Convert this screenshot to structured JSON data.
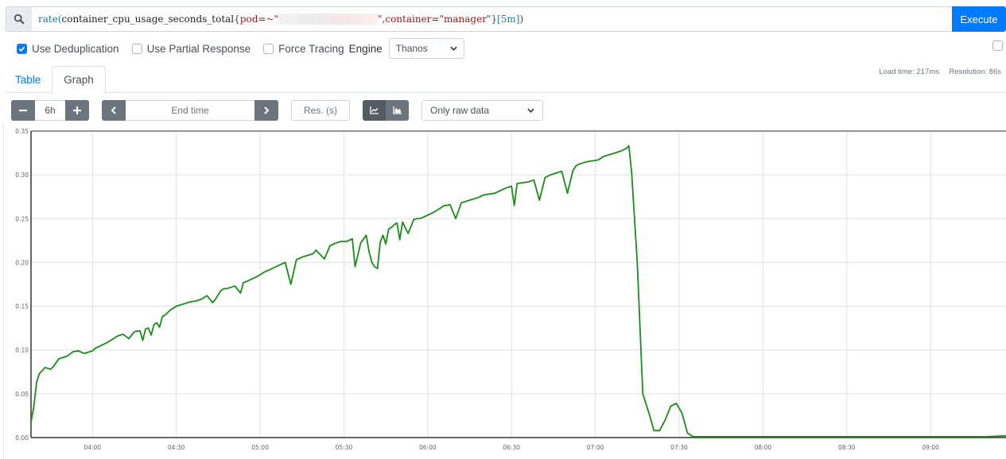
{
  "query": {
    "search_icon": "search-icon",
    "parts": {
      "fn": "rate(",
      "metric": "container_cpu_usage_seconds_total",
      "open_brace": "{",
      "label1": "pod=~\"",
      "label1_end": "\"",
      "label2": ",container=\"manager\"",
      "close_brace": "}",
      "range": "[5m]",
      "close_paren": ")"
    },
    "execute_label": "Execute"
  },
  "options": {
    "dedup": {
      "label": "Use Deduplication",
      "checked": true
    },
    "partial": {
      "label": "Use Partial Response",
      "checked": false
    },
    "tracing": {
      "label": "Force Tracing",
      "checked": false
    },
    "engine_label": "Engine",
    "engine_value": "Thanos"
  },
  "status": {
    "load_time": "Load time: 217ms",
    "resolution": "Resolution: 86s"
  },
  "tabs": [
    {
      "label": "Table",
      "active": false
    },
    {
      "label": "Graph",
      "active": true
    }
  ],
  "controls": {
    "minus_label": "−",
    "range_value": "6h",
    "plus_label": "+",
    "prev_label": "‹",
    "end_time_placeholder": "End time",
    "next_label": "›",
    "res_placeholder": "Res. (s)",
    "downsampling_value": "Only raw data"
  },
  "colors": {
    "accent": "#007bff",
    "series": "#1a8c1a",
    "grid": "#e0e0e0",
    "axis": "#333333"
  },
  "chart_data": {
    "type": "line",
    "title": "",
    "xlabel": "",
    "ylabel": "",
    "x_unit": "time (HH:MM)",
    "xlim": [
      "03:38",
      "09:27"
    ],
    "ylim": [
      0,
      0.35
    ],
    "grid": true,
    "legend": "none",
    "y_ticks": [
      "0.00",
      "0.05",
      "0.10",
      "0.15",
      "0.20",
      "0.25",
      "0.30",
      "0.35"
    ],
    "x_ticks": [
      "04:00",
      "04:30",
      "05:00",
      "05:30",
      "06:00",
      "06:30",
      "07:00",
      "07:30",
      "08:00",
      "08:30",
      "09:00"
    ],
    "series": [
      {
        "name": "rate(container_cpu_usage_seconds_total{container=\"manager\"}[5m])",
        "x": [
          "03:38",
          "03:39",
          "03:40",
          "03:41",
          "03:43",
          "03:45",
          "03:46",
          "03:48",
          "03:49",
          "03:51",
          "03:53",
          "03:55",
          "03:57",
          "03:58",
          "04:00",
          "04:01",
          "04:03",
          "04:05",
          "04:07",
          "04:09",
          "04:11",
          "04:13",
          "04:15",
          "04:17",
          "04:18",
          "04:19",
          "04:20",
          "04:21",
          "04:22",
          "04:23",
          "04:24",
          "04:25",
          "04:26",
          "04:27",
          "04:28",
          "04:29",
          "04:30",
          "04:31",
          "04:33",
          "04:35",
          "04:37",
          "04:39",
          "04:41",
          "04:43",
          "04:44",
          "04:46",
          "04:47",
          "04:48",
          "04:50",
          "04:51",
          "04:53",
          "04:54",
          "04:55",
          "04:57",
          "04:59",
          "05:00",
          "05:01",
          "05:02",
          "05:03",
          "05:05",
          "05:07",
          "05:09",
          "05:11",
          "05:13",
          "05:15",
          "05:17",
          "05:19",
          "05:20",
          "05:23",
          "05:25",
          "05:27",
          "05:29",
          "05:31",
          "05:33",
          "05:34",
          "05:36",
          "05:38",
          "05:39",
          "05:40",
          "05:41",
          "05:42",
          "05:43",
          "05:44",
          "05:45",
          "05:46",
          "05:47",
          "05:48",
          "05:49",
          "05:50",
          "05:51",
          "05:53",
          "05:55",
          "05:56",
          "05:57",
          "05:58",
          "06:00",
          "06:02",
          "06:03",
          "06:04",
          "06:05",
          "06:06",
          "06:07",
          "06:08",
          "06:10",
          "06:12",
          "06:14",
          "06:16",
          "06:18",
          "06:20",
          "06:22",
          "06:24",
          "06:26",
          "06:28",
          "06:30",
          "06:31",
          "06:32",
          "06:34",
          "06:36",
          "06:38",
          "06:40",
          "06:42",
          "06:44",
          "06:46",
          "06:48",
          "06:50",
          "06:52",
          "06:53",
          "06:54",
          "06:55",
          "06:57",
          "06:59",
          "07:01",
          "07:02",
          "07:03",
          "07:05",
          "07:07",
          "07:09",
          "07:11",
          "07:12",
          "07:13",
          "07:15",
          "07:17",
          "07:19",
          "07:21",
          "07:23",
          "07:25",
          "07:27",
          "07:29",
          "07:31",
          "07:33",
          "07:35",
          "07:37",
          "07:39",
          "07:40",
          "07:41",
          "07:43",
          "07:45",
          "07:47",
          "07:49",
          "07:50",
          "07:52",
          "07:54",
          "07:55",
          "07:56",
          "07:57",
          "07:58",
          "08:00",
          "08:30",
          "09:00",
          "09:20",
          "09:27"
        ],
        "y": [
          0.018,
          0.035,
          0.063,
          0.073,
          0.08,
          0.078,
          0.081,
          0.09,
          0.091,
          0.093,
          0.098,
          0.099,
          0.096,
          0.097,
          0.099,
          0.102,
          0.105,
          0.108,
          0.112,
          0.116,
          0.118,
          0.113,
          0.121,
          0.122,
          0.111,
          0.124,
          0.125,
          0.117,
          0.129,
          0.131,
          0.126,
          0.138,
          0.14,
          0.143,
          0.146,
          0.148,
          0.15,
          0.151,
          0.153,
          0.155,
          0.156,
          0.158,
          0.162,
          0.154,
          0.158,
          0.168,
          0.17,
          0.17,
          0.172,
          0.173,
          0.165,
          0.177,
          0.178,
          0.181,
          0.184,
          0.186,
          0.188,
          0.19,
          0.191,
          0.194,
          0.197,
          0.2,
          0.175,
          0.203,
          0.206,
          0.208,
          0.21,
          0.214,
          0.204,
          0.219,
          0.222,
          0.224,
          0.224,
          0.227,
          0.195,
          0.222,
          0.231,
          0.212,
          0.2,
          0.195,
          0.193,
          0.223,
          0.231,
          0.221,
          0.238,
          0.24,
          0.243,
          0.245,
          0.226,
          0.246,
          0.233,
          0.249,
          0.25,
          0.25,
          0.251,
          0.254,
          0.257,
          0.259,
          0.261,
          0.263,
          0.265,
          0.265,
          0.266,
          0.25,
          0.268,
          0.27,
          0.272,
          0.274,
          0.277,
          0.278,
          0.279,
          0.282,
          0.285,
          0.287,
          0.265,
          0.29,
          0.291,
          0.292,
          0.294,
          0.271,
          0.297,
          0.3,
          0.302,
          0.304,
          0.279,
          0.305,
          0.31,
          0.312,
          0.313,
          0.315,
          0.316,
          0.317,
          0.319,
          0.321,
          0.323,
          0.325,
          0.327,
          0.33,
          0.333,
          0.302,
          0.2,
          0.05,
          0.03,
          0.008,
          0.008,
          0.02,
          0.036,
          0.039,
          0.028,
          0.005,
          0.001,
          0.001,
          0.001,
          0.001,
          0.001,
          0.001,
          0.001,
          0.001,
          0.001,
          0.001,
          0.001,
          0.001,
          0.001,
          0.001,
          0.001,
          0.001,
          0.001,
          0.001,
          0.001,
          0.001,
          0.002,
          0.002
        ]
      }
    ]
  }
}
